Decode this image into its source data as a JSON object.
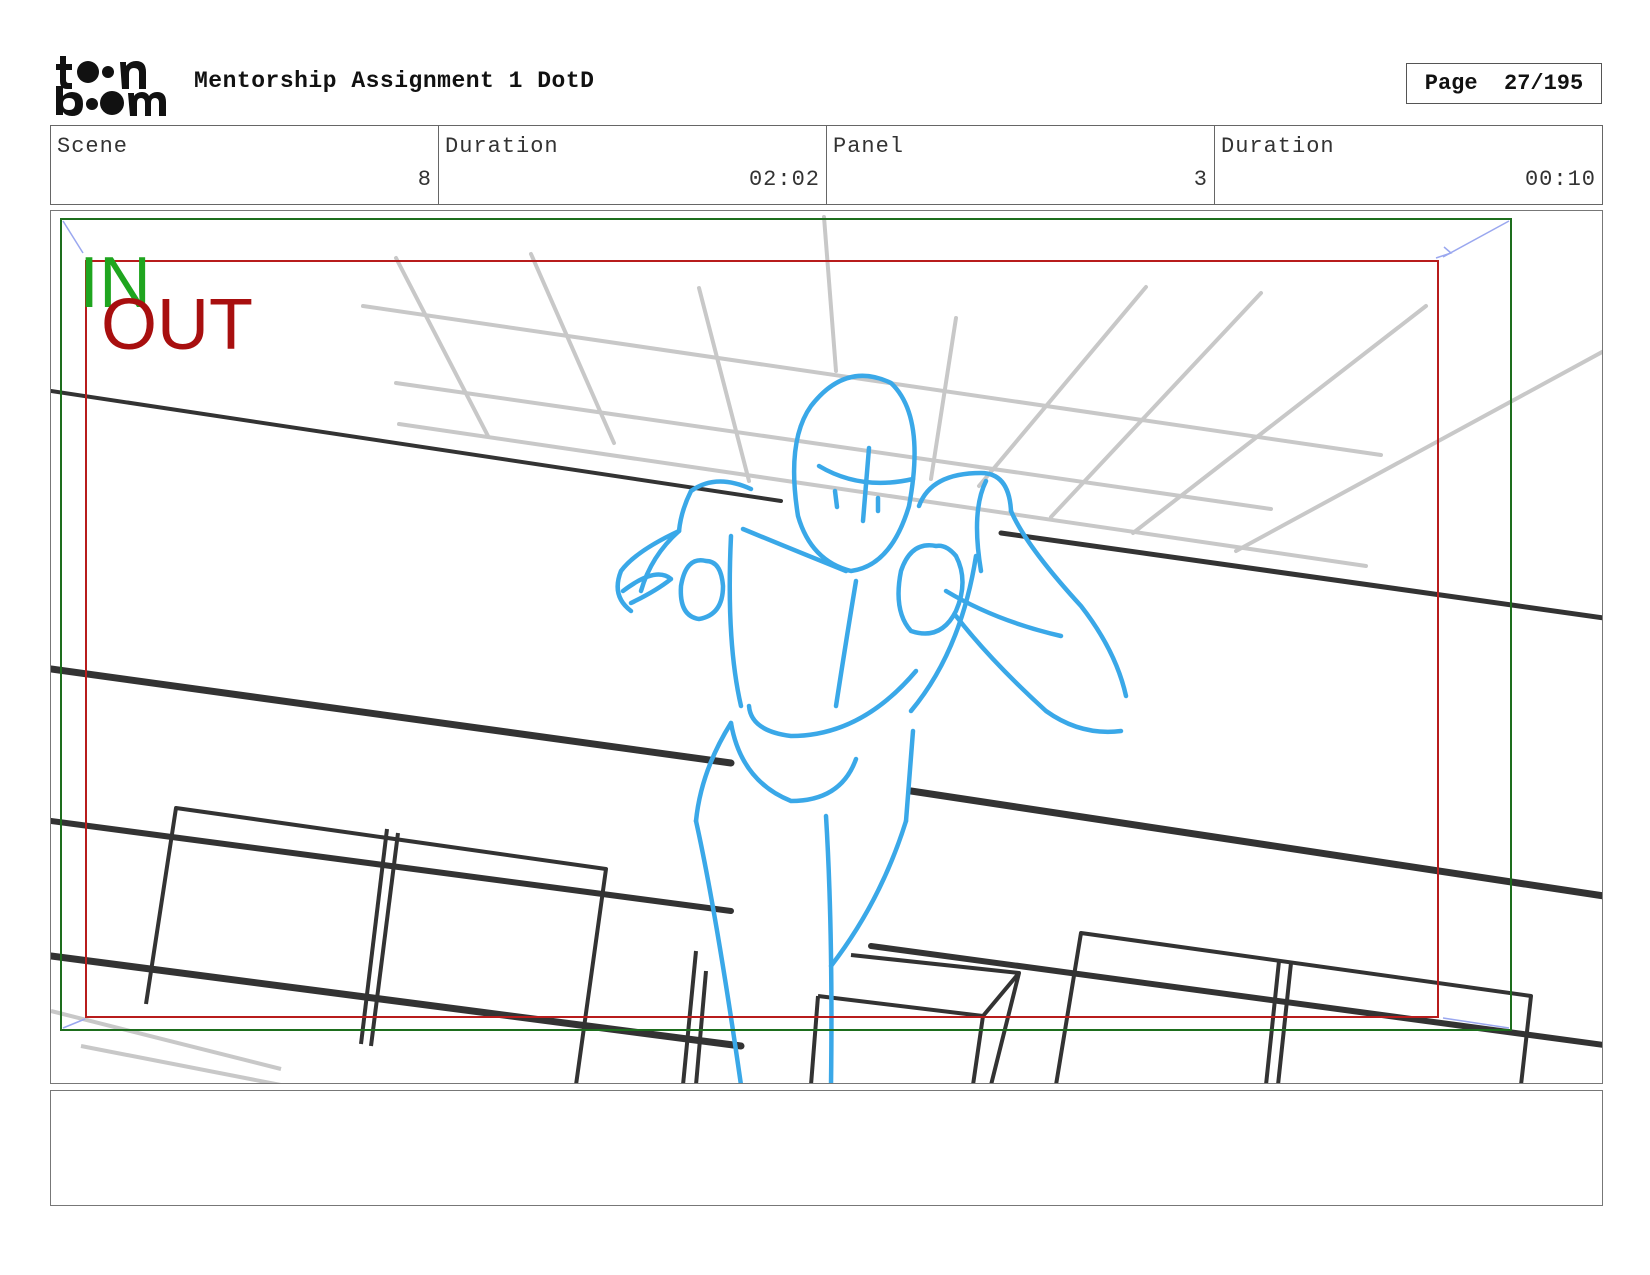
{
  "header": {
    "logo_text": "toon boom",
    "title": "Mentorship Assignment 1 DotD",
    "page_label": "Page",
    "page_value": "27/195"
  },
  "info": [
    {
      "label": "Scene",
      "value": "8"
    },
    {
      "label": "Duration",
      "value": "02:02"
    },
    {
      "label": "Panel",
      "value": "3"
    },
    {
      "label": "Duration",
      "value": "00:10"
    }
  ],
  "frame": {
    "in_label": "IN",
    "out_label": "OUT",
    "colors": {
      "in": "#1fa51f",
      "out": "#a80f0f",
      "sketch": "#3aa8e8",
      "lines": "#333333",
      "grid": "#c8c8c8"
    }
  },
  "notes": {
    "text": ""
  }
}
